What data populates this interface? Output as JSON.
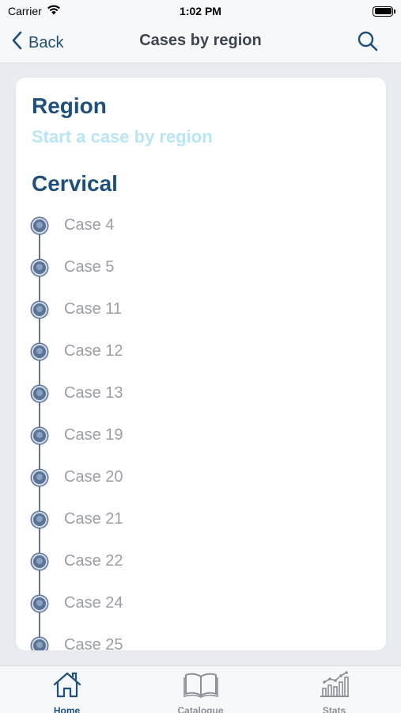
{
  "status_bar": {
    "carrier": "Carrier",
    "time": "1:02 PM"
  },
  "nav": {
    "back_label": "Back",
    "title": "Cases by region"
  },
  "card": {
    "region_title": "Region",
    "region_subtitle": "Start a case by region",
    "section_title": "Cervical",
    "cases": [
      {
        "label": "Case 4"
      },
      {
        "label": "Case 5"
      },
      {
        "label": "Case 11"
      },
      {
        "label": "Case 12"
      },
      {
        "label": "Case 13"
      },
      {
        "label": "Case 19"
      },
      {
        "label": "Case 20"
      },
      {
        "label": "Case 21"
      },
      {
        "label": "Case 22"
      },
      {
        "label": "Case 24"
      },
      {
        "label": "Case 25"
      }
    ]
  },
  "tab_bar": {
    "tabs": [
      {
        "label": "Home",
        "icon": "house-icon",
        "active": true
      },
      {
        "label": "Catalogue",
        "icon": "book-icon",
        "active": false
      },
      {
        "label": "Stats",
        "icon": "chart-icon",
        "active": false
      }
    ]
  },
  "colors": {
    "accent": "#1f5079",
    "subtitle": "#b8e6f7",
    "case_text": "#9a9ea5",
    "timeline_dot": "#5b7395"
  }
}
